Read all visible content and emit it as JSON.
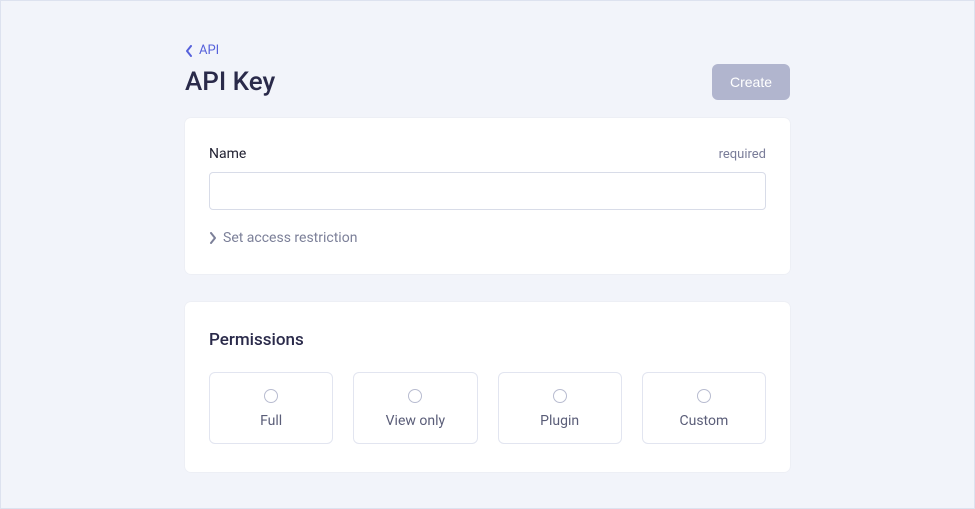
{
  "breadcrumb": {
    "label": "API"
  },
  "header": {
    "title": "API Key",
    "create_label": "Create"
  },
  "name_field": {
    "label": "Name",
    "required_tag": "required",
    "value": ""
  },
  "access_restriction": {
    "label": "Set access restriction"
  },
  "permissions": {
    "title": "Permissions",
    "options": [
      {
        "label": "Full"
      },
      {
        "label": "View only"
      },
      {
        "label": "Plugin"
      },
      {
        "label": "Custom"
      }
    ]
  }
}
